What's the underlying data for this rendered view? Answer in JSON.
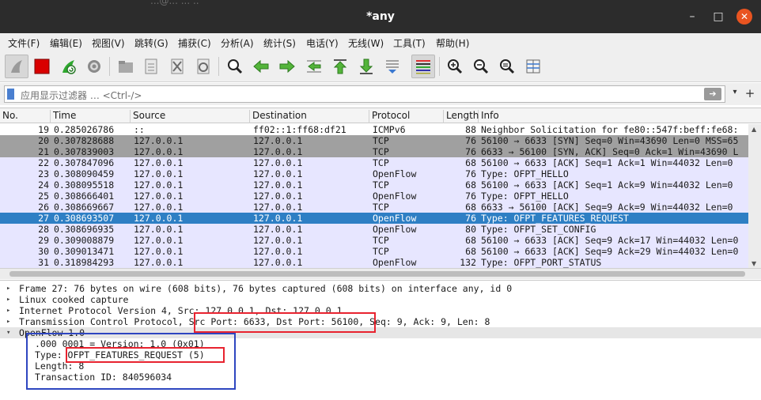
{
  "window": {
    "title": "*any",
    "ghost_text": "...@...             ...  ..",
    "minimize": "–",
    "maximize": "□",
    "close": "✕"
  },
  "menu": [
    "文件(F)",
    "编辑(E)",
    "视图(V)",
    "跳转(G)",
    "捕获(C)",
    "分析(A)",
    "统计(S)",
    "电话(Y)",
    "无线(W)",
    "工具(T)",
    "帮助(H)"
  ],
  "filter": {
    "placeholder": "应用显示过滤器 … <Ctrl-/>",
    "apply_glyph": "➔",
    "dropdown_glyph": "▾",
    "plus_glyph": "+"
  },
  "packet_list": {
    "columns": [
      "No.",
      "Time",
      "Source",
      "Destination",
      "Protocol",
      "Length",
      "Info"
    ],
    "rows": [
      {
        "no": "19",
        "time": "0.285026786",
        "src": "::",
        "dst": "ff02::1:ff68:df21",
        "proto": "ICMPv6",
        "len": "88",
        "info": "Neighbor Solicitation for fe80::547f:beff:fe68:",
        "style": "white"
      },
      {
        "no": "20",
        "time": "0.307828688",
        "src": "127.0.0.1",
        "dst": "127.0.0.1",
        "proto": "TCP",
        "len": "76",
        "info": "56100 → 6633 [SYN] Seq=0 Win=43690 Len=0 MSS=65",
        "style": "gray"
      },
      {
        "no": "21",
        "time": "0.307839003",
        "src": "127.0.0.1",
        "dst": "127.0.0.1",
        "proto": "TCP",
        "len": "76",
        "info": "6633 → 56100 [SYN, ACK] Seq=0 Ack=1 Win=43690 L",
        "style": "gray"
      },
      {
        "no": "22",
        "time": "0.307847096",
        "src": "127.0.0.1",
        "dst": "127.0.0.1",
        "proto": "TCP",
        "len": "68",
        "info": "56100 → 6633 [ACK] Seq=1 Ack=1 Win=44032 Len=0",
        "style": "lav"
      },
      {
        "no": "23",
        "time": "0.308090459",
        "src": "127.0.0.1",
        "dst": "127.0.0.1",
        "proto": "OpenFlow",
        "len": "76",
        "info": "Type: OFPT_HELLO",
        "style": "lav"
      },
      {
        "no": "24",
        "time": "0.308095518",
        "src": "127.0.0.1",
        "dst": "127.0.0.1",
        "proto": "TCP",
        "len": "68",
        "info": "56100 → 6633 [ACK] Seq=1 Ack=9 Win=44032 Len=0",
        "style": "lav"
      },
      {
        "no": "25",
        "time": "0.308666401",
        "src": "127.0.0.1",
        "dst": "127.0.0.1",
        "proto": "OpenFlow",
        "len": "76",
        "info": "Type: OFPT_HELLO",
        "style": "lav"
      },
      {
        "no": "26",
        "time": "0.308669667",
        "src": "127.0.0.1",
        "dst": "127.0.0.1",
        "proto": "TCP",
        "len": "68",
        "info": "6633 → 56100 [ACK] Seq=9 Ack=9 Win=44032 Len=0",
        "style": "lav"
      },
      {
        "no": "27",
        "time": "0.308693507",
        "src": "127.0.0.1",
        "dst": "127.0.0.1",
        "proto": "OpenFlow",
        "len": "76",
        "info": "Type: OFPT_FEATURES_REQUEST",
        "style": "sel"
      },
      {
        "no": "28",
        "time": "0.308696935",
        "src": "127.0.0.1",
        "dst": "127.0.0.1",
        "proto": "OpenFlow",
        "len": "80",
        "info": "Type: OFPT_SET_CONFIG",
        "style": "lav"
      },
      {
        "no": "29",
        "time": "0.309008879",
        "src": "127.0.0.1",
        "dst": "127.0.0.1",
        "proto": "TCP",
        "len": "68",
        "info": "56100 → 6633 [ACK] Seq=9 Ack=17 Win=44032 Len=0",
        "style": "lav"
      },
      {
        "no": "30",
        "time": "0.309013471",
        "src": "127.0.0.1",
        "dst": "127.0.0.1",
        "proto": "TCP",
        "len": "68",
        "info": "56100 → 6633 [ACK] Seq=9 Ack=29 Win=44032 Len=0",
        "style": "lav"
      },
      {
        "no": "31",
        "time": "0.318984293",
        "src": "127.0.0.1",
        "dst": "127.0.0.1",
        "proto": "OpenFlow",
        "len": "132",
        "info": "Type: OFPT_PORT_STATUS",
        "style": "lav"
      }
    ]
  },
  "details": {
    "rows": [
      {
        "text": "Frame 27: 76 bytes on wire (608 bits), 76 bytes captured (608 bits) on interface any, id 0",
        "arrow": "▸"
      },
      {
        "text": "Linux cooked capture",
        "arrow": "▸"
      },
      {
        "text": "Internet Protocol Version 4, Src: 127.0.0.1, Dst: 127.0.0.1",
        "arrow": "▸"
      },
      {
        "text": "Transmission Control Protocol, Src Port: 6633, Dst Port: 56100, Seq: 9, Ack: 9, Len: 8",
        "arrow": "▸"
      },
      {
        "text": "OpenFlow 1.0",
        "arrow": "▾"
      }
    ],
    "openflow": [
      ".000 0001 = Version: 1.0 (0x01)",
      "Type: OFPT_FEATURES_REQUEST (5)",
      "Length: 8",
      "Transaction ID: 840596034"
    ]
  },
  "colors": {
    "selected_row": "#2e7fc4",
    "gray_row": "#a0a0a0",
    "lavender_row": "#e7e6ff",
    "annotation_red": "#e8232f",
    "annotation_blue": "#2e46c0"
  }
}
